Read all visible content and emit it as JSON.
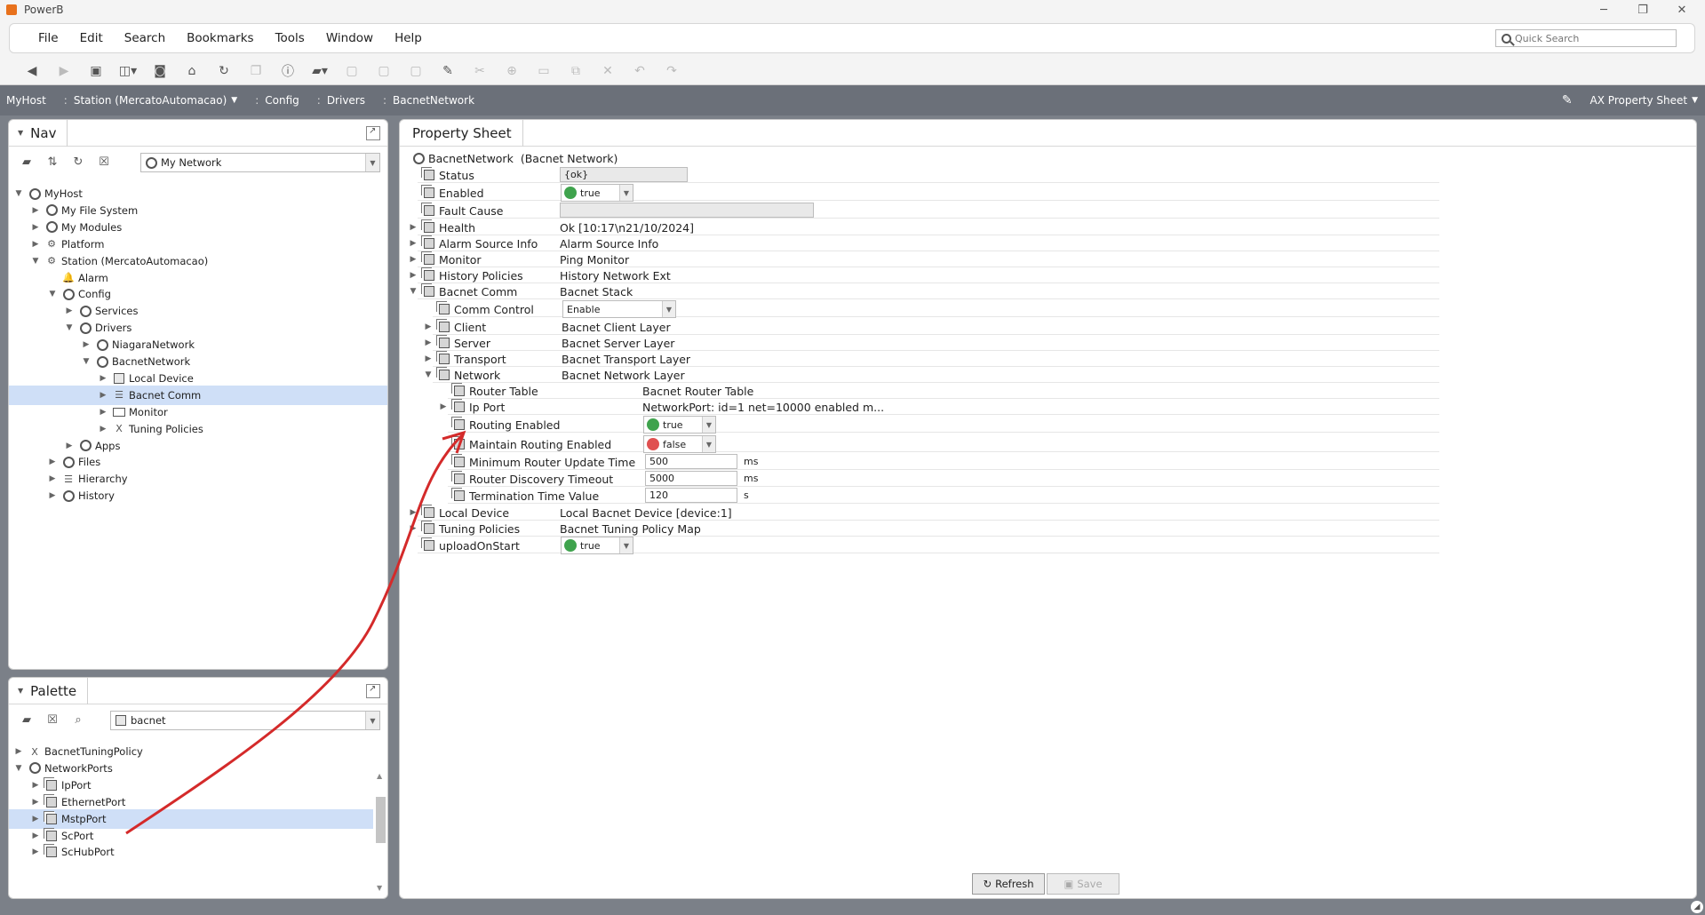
{
  "app": {
    "title": "PowerB"
  },
  "window_controls": {
    "minimize": "─",
    "restore": "❐",
    "close": "✕"
  },
  "menu": [
    "File",
    "Edit",
    "Search",
    "Bookmarks",
    "Tools",
    "Window",
    "Help"
  ],
  "quick_search": {
    "placeholder": "Quick Search"
  },
  "locator": {
    "items": [
      "MyHost",
      "Station (MercatoAutomacao)",
      "Config",
      "Drivers",
      "BacnetNetwork"
    ],
    "view": "AX Property Sheet"
  },
  "nav": {
    "title": "Nav",
    "combo": "My Network",
    "tree": [
      {
        "label": "MyHost",
        "icon": "host-icon",
        "level": 0,
        "expanded": true
      },
      {
        "label": "My File System",
        "icon": "filesystem-icon",
        "level": 1
      },
      {
        "label": "My Modules",
        "icon": "modules-icon",
        "level": 1
      },
      {
        "label": "Platform",
        "icon": "platform-icon",
        "level": 1
      },
      {
        "label": "Station (MercatoAutomacao)",
        "icon": "station-icon",
        "level": 1,
        "expanded": true
      },
      {
        "label": "Alarm",
        "icon": "bell-icon",
        "level": 2,
        "leaf": true
      },
      {
        "label": "Config",
        "icon": "config-icon",
        "level": 2,
        "expanded": true
      },
      {
        "label": "Services",
        "icon": "services-icon",
        "level": 3
      },
      {
        "label": "Drivers",
        "icon": "drivers-icon",
        "level": 3,
        "expanded": true
      },
      {
        "label": "NiagaraNetwork",
        "icon": "network-icon",
        "level": 4
      },
      {
        "label": "BacnetNetwork",
        "icon": "network-icon",
        "level": 4,
        "expanded": true
      },
      {
        "label": "Local Device",
        "icon": "device-icon",
        "level": 5
      },
      {
        "label": "Bacnet Comm",
        "icon": "stack-icon",
        "level": 5,
        "selected": true
      },
      {
        "label": "Monitor",
        "icon": "monitor-icon",
        "level": 5
      },
      {
        "label": "Tuning Policies",
        "icon": "tuning-icon",
        "level": 5
      },
      {
        "label": "Apps",
        "icon": "apps-icon",
        "level": 3
      },
      {
        "label": "Files",
        "icon": "files-icon",
        "level": 2
      },
      {
        "label": "Hierarchy",
        "icon": "hierarchy-icon",
        "level": 2
      },
      {
        "label": "History",
        "icon": "history-icon",
        "level": 2
      }
    ]
  },
  "palette": {
    "title": "Palette",
    "combo": "bacnet",
    "tree": [
      {
        "label": "BacnetTuningPolicy",
        "icon": "tuning-icon",
        "level": 0
      },
      {
        "label": "NetworkPorts",
        "icon": "folder-icon",
        "level": 0,
        "expanded": true
      },
      {
        "label": "IpPort",
        "icon": "port-icon",
        "level": 1
      },
      {
        "label": "EthernetPort",
        "icon": "port-icon",
        "level": 1
      },
      {
        "label": "MstpPort",
        "icon": "port-icon",
        "level": 1,
        "selected": true
      },
      {
        "label": "ScPort",
        "icon": "port-icon",
        "level": 1
      },
      {
        "label": "ScHubPort",
        "icon": "port-icon",
        "level": 1
      }
    ]
  },
  "property_sheet": {
    "tab": "Property Sheet",
    "root": {
      "name": "BacnetNetwork",
      "type": "(Bacnet Network)"
    },
    "rows": [
      {
        "name": "Status",
        "value": "{ok}",
        "kind": "ro-field"
      },
      {
        "name": "Enabled",
        "value": "true",
        "kind": "bool",
        "color": "#3fa34d"
      },
      {
        "name": "Fault Cause",
        "value": "",
        "kind": "ro-field"
      },
      {
        "name": "Health",
        "value": "Ok [10:17\\n21/10/2024]",
        "kind": "text"
      },
      {
        "name": "Alarm Source Info",
        "value": "Alarm Source Info",
        "kind": "text"
      },
      {
        "name": "Monitor",
        "value": "Ping Monitor",
        "kind": "text"
      },
      {
        "name": "History Policies",
        "value": "History Network Ext",
        "kind": "text"
      },
      {
        "name": "Bacnet Comm",
        "value": "Bacnet Stack",
        "kind": "text"
      },
      {
        "name": "Comm Control",
        "value": "Enable",
        "kind": "combo"
      },
      {
        "name": "Client",
        "value": "Bacnet Client Layer",
        "kind": "text"
      },
      {
        "name": "Server",
        "value": "Bacnet Server Layer",
        "kind": "text"
      },
      {
        "name": "Transport",
        "value": "Bacnet Transport Layer",
        "kind": "text"
      },
      {
        "name": "Network",
        "value": "Bacnet Network Layer",
        "kind": "text"
      },
      {
        "name": "Router Table",
        "value": "Bacnet Router Table",
        "kind": "text"
      },
      {
        "name": "Ip Port",
        "value": "NetworkPort: id=1 net=10000 enabled m...",
        "kind": "text"
      },
      {
        "name": "Routing Enabled",
        "value": "true",
        "kind": "bool",
        "color": "#3fa34d"
      },
      {
        "name": "Maintain Routing Enabled",
        "value": "false",
        "kind": "bool",
        "color": "#e05050"
      },
      {
        "name": "Minimum Router Update Time",
        "value": "500",
        "kind": "field",
        "unit": "ms"
      },
      {
        "name": "Router Discovery Timeout",
        "value": "5000",
        "kind": "field",
        "unit": "ms"
      },
      {
        "name": "Termination Time Value",
        "value": "120",
        "kind": "field",
        "unit": "s"
      },
      {
        "name": "Local Device",
        "value": "Local Bacnet Device [device:1]",
        "kind": "text"
      },
      {
        "name": "Tuning Policies",
        "value": "Bacnet Tuning Policy Map",
        "kind": "text"
      },
      {
        "name": "uploadOnStart",
        "value": "true",
        "kind": "bool",
        "color": "#3fa34d"
      }
    ]
  },
  "buttons": {
    "refresh": "Refresh",
    "save": "Save"
  },
  "colors": {
    "accent_arrow": "#d42a2a",
    "selection": "#cfdff7",
    "locator_bg": "#6b7079"
  }
}
